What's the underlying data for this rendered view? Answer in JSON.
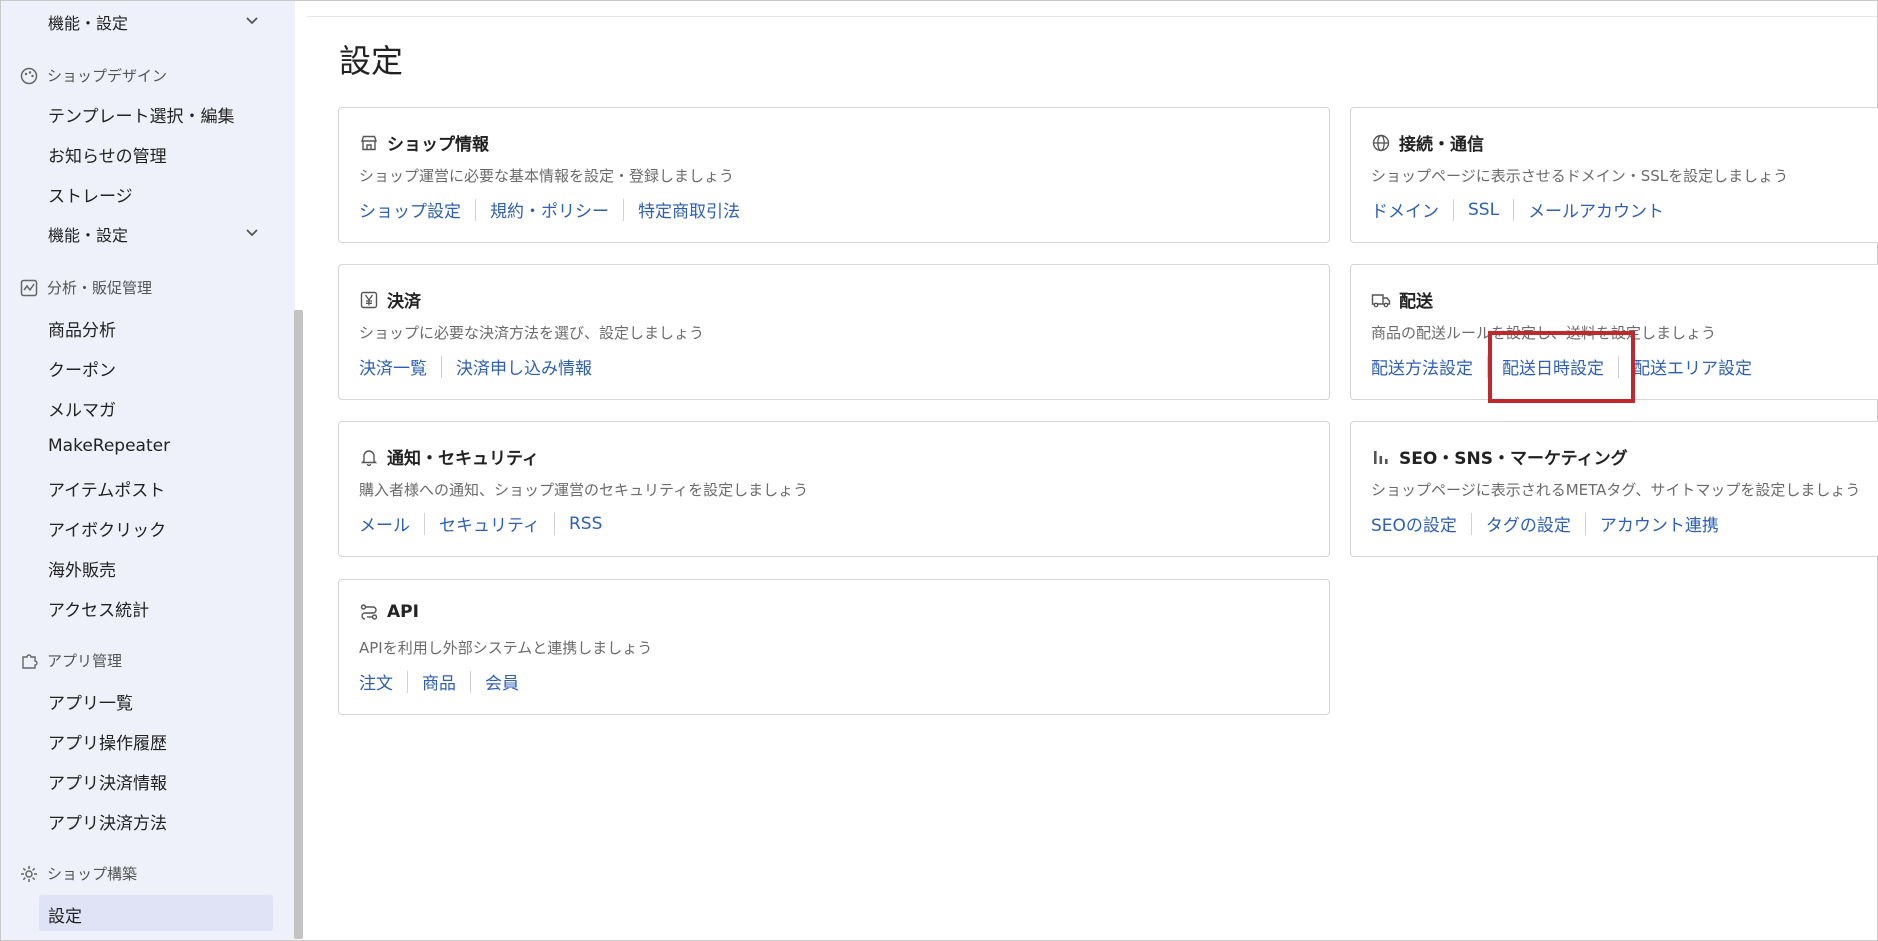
{
  "sidebar": {
    "top_item": "機能・設定",
    "sections": [
      {
        "label": "ショップデザイン",
        "icon": "palette-icon"
      },
      {
        "label": "分析・販促管理",
        "icon": "chart-icon"
      },
      {
        "label": "アプリ管理",
        "icon": "puzzle-icon"
      },
      {
        "label": "ショップ構築",
        "icon": "gear-icon"
      }
    ],
    "design_items": [
      "テンプレート選択・編集",
      "お知らせの管理",
      "ストレージ",
      "機能・設定"
    ],
    "analysis_items": [
      "商品分析",
      "クーポン",
      "メルマガ",
      "MakeRepeater",
      "アイテムポスト",
      "アイボクリック",
      "海外販売",
      "アクセス統計"
    ],
    "app_items": [
      "アプリ一覧",
      "アプリ操作履歴",
      "アプリ決済情報",
      "アプリ決済方法"
    ],
    "build_items": [
      "設定"
    ],
    "active_item": "設定"
  },
  "page": {
    "title": "設定"
  },
  "cards": [
    {
      "title": "ショップ情報",
      "icon": "storefront-icon",
      "desc": "ショップ運営に必要な基本情報を設定・登録しましょう",
      "links": [
        "ショップ設定",
        "規約・ポリシー",
        "特定商取引法"
      ]
    },
    {
      "title": "接続・通信",
      "icon": "globe-icon",
      "desc": "ショップページに表示させるドメイン・SSLを設定しましょう",
      "links": [
        "ドメイン",
        "SSL",
        "メールアカウント"
      ]
    },
    {
      "title": "決済",
      "icon": "yen-icon",
      "desc": "ショップに必要な決済方法を選び、設定しましょう",
      "links": [
        "決済一覧",
        "決済申し込み情報"
      ]
    },
    {
      "title": "配送",
      "icon": "truck-icon",
      "desc": "商品の配送ルールを設定し、送料を設定しましょう",
      "links": [
        "配送方法設定",
        "配送日時設定",
        "配送エリア設定"
      ]
    },
    {
      "title": "通知・セキュリティ",
      "icon": "bell-icon",
      "desc": "購入者様への通知、ショップ運営のセキュリティを設定しましょう",
      "links": [
        "メール",
        "セキュリティ",
        "RSS"
      ]
    },
    {
      "title": "SEO・SNS・マーケティング",
      "icon": "bar-chart-icon",
      "desc": "ショップページに表示されるMETAタグ、サイトマップを設定しましょう",
      "links": [
        "SEOの設定",
        "タグの設定",
        "アカウント連携"
      ]
    },
    {
      "title": "API",
      "icon": "api-icon",
      "desc": "APIを利用し外部システムと連携しましょう",
      "links": [
        "注文",
        "商品",
        "会員"
      ]
    }
  ],
  "highlighted_link": "配送日時設定",
  "colors": {
    "link": "#2d5fb8",
    "highlight": "#c0282b",
    "sidebar_bg": "#eef1fa",
    "active_bg": "#dfe3f5"
  }
}
